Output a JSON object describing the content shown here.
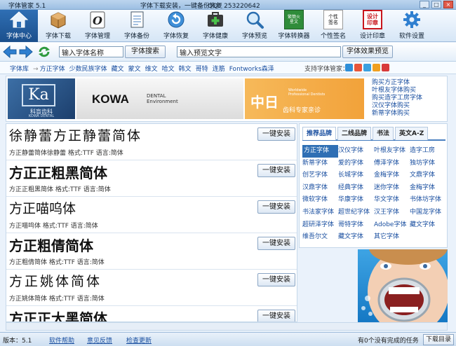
{
  "window": {
    "title": "字体管家 5.1",
    "slogan": "字体下载安装，一键备份恢复",
    "qq": "QQ：253220642",
    "min_label": "_",
    "max_label": "□",
    "close_label": "×"
  },
  "toolbar": {
    "items": [
      {
        "label": "字体中心",
        "icon": "house-icon"
      },
      {
        "label": "字体下载",
        "icon": "box-icon"
      },
      {
        "label": "字体管理",
        "icon": "font-icon"
      },
      {
        "label": "字体备份",
        "icon": "document-icon"
      },
      {
        "label": "字体恢复",
        "icon": "restore-icon"
      },
      {
        "label": "字体健康",
        "icon": "first-aid-icon"
      },
      {
        "label": "字体预览",
        "icon": "magnifier-icon"
      },
      {
        "label": "字体转换器",
        "icon": "convert-icon"
      },
      {
        "label": "个性签名",
        "icon": "signature-icon"
      },
      {
        "label": "设计印章",
        "icon": "seal-icon"
      },
      {
        "label": "软件设置",
        "icon": "gear-icon"
      }
    ],
    "convert_glyphs": "繁簡火星文",
    "signature_glyphs": "个性签名",
    "seal_glyphs": "设计印章"
  },
  "search": {
    "font_name_value": "输入字体名称",
    "font_search_button": "字体搜索",
    "preview_value": "输入预览文字",
    "preview_button": "字体效果预览"
  },
  "categories": {
    "items": [
      "字体库",
      "方正字体",
      "少数民族字体",
      "藏文",
      "蒙文",
      "维文",
      "哈文",
      "韩文",
      "哥特",
      "连筋",
      "Fontworks森泽"
    ],
    "support_label": "支持字体管家："
  },
  "banner": {
    "logo_mark": "Ka",
    "logo_cn": "科盲齿科",
    "logo_en": "KOWA DENTAL",
    "brand": "KOWA",
    "dental_lines": [
      "DENTAL",
      "Environment"
    ],
    "ad_big": "中日",
    "ad_small": "齿科专家亲诊",
    "ad_tiny": [
      "Worldwide",
      "Professional Dentists"
    ],
    "links": [
      "购买方正字体",
      "叶根友字体购买",
      "购买造字工房字体",
      "汉仪字体购买",
      "新蒂字体购买"
    ]
  },
  "fonts": [
    {
      "preview": "徐静蕾方正静蕾简体",
      "meta": "方正静蕾简体徐静蕾  格式:TTF 语言:简体",
      "install": "一键安装",
      "bold": false
    },
    {
      "preview": "方正正粗黑简体",
      "meta": "方正正粗黑简体  格式:TTF 语言:简体",
      "install": "一键安装",
      "bold": true
    },
    {
      "preview": "方正喵呜体",
      "meta": "方正喵呜体  格式:TTF 语言:简体",
      "install": "一键安装",
      "bold": false
    },
    {
      "preview": "方正粗倩简体",
      "meta": "方正粗倩简体  格式:TTF 语言:简体",
      "install": "一键安装",
      "bold": true
    },
    {
      "preview": "方正姚体简体",
      "meta": "方正姚体简体  格式:TTF 语言:简体",
      "install": "一键安装",
      "bold": false
    },
    {
      "preview": "方正正大黑简体",
      "meta": "",
      "install": "一键安装",
      "bold": true
    }
  ],
  "brands": {
    "tabs": [
      "推荐品牌",
      "二线品牌",
      "书法",
      "英文A-Z"
    ],
    "items": [
      "方正字体",
      "汉仪字体",
      "叶根友字体",
      "造字工房",
      "新蒂字体",
      "爱的字体",
      "傅泽字体",
      "独坊字体",
      "创艺字体",
      "长城字体",
      "金梅字体",
      "文鼎字体",
      "汉鼎字体",
      "经典字体",
      "迷你字体",
      "金梅字体",
      "微软字体",
      "华康字体",
      "华文字体",
      "书体坊字体",
      "书法家字体",
      "超世纪字体",
      "汉王字体",
      "中国龙字体",
      "超研泽字体",
      "哥特字体",
      "Adobe字体",
      "藏文字体",
      "维吾尔文",
      "藏文字体",
      "其它字体"
    ]
  },
  "status": {
    "version": "版本：5.1",
    "help": "软件帮助",
    "feedback": "意见反馈",
    "update": "检查更新",
    "tasks": "有0个没有完成的任务",
    "download_dir": "下载目录"
  },
  "colors": {
    "accent": "#2f6fb4",
    "link": "#1a4fa0",
    "toolbar_bg": "#d6e6f6"
  }
}
